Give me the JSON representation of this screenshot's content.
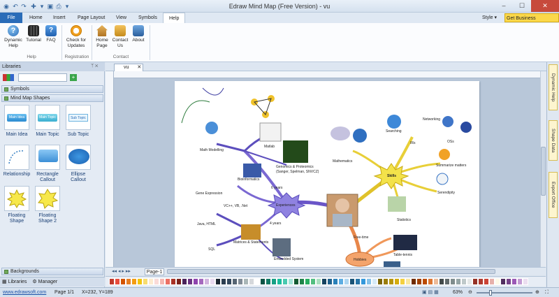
{
  "window": {
    "title": "Edraw Mind Map (Free Version) - vu",
    "minimize": "–",
    "maximize": "☐",
    "close": "✕"
  },
  "tabs": [
    {
      "label": "File"
    },
    {
      "label": "Home"
    },
    {
      "label": "Insert"
    },
    {
      "label": "Page Layout"
    },
    {
      "label": "View"
    },
    {
      "label": "Symbols"
    },
    {
      "label": "Help"
    }
  ],
  "style_label": "Style",
  "business_label": "Get Business Version...",
  "ribbon": {
    "buttons": [
      {
        "label": "Dynamic Help",
        "l1": "Dynamic",
        "l2": "Help"
      },
      {
        "label": "Tutorial",
        "l1": "Tutorial",
        "l2": ""
      },
      {
        "label": "FAQ",
        "l1": "FAQ",
        "l2": ""
      },
      {
        "label": "Check for Updates",
        "l1": "Check for",
        "l2": "Updates"
      },
      {
        "label": "Home Page",
        "l1": "Home",
        "l2": "Page"
      },
      {
        "label": "Contact Us",
        "l1": "Contact",
        "l2": "Us"
      },
      {
        "label": "About",
        "l1": "About",
        "l2": ""
      }
    ],
    "groups": [
      "Help",
      "Registration",
      "Contact"
    ]
  },
  "library": {
    "title": "Libraries",
    "pin": "ᛘ ✕",
    "sections": [
      "Symbols",
      "Mind Map Shapes",
      "Backgrounds"
    ],
    "shapes": [
      {
        "label1": "Main Idea",
        "label2": "",
        "preview": "Main Idea"
      },
      {
        "label1": "Main Topic",
        "label2": "",
        "preview": "Main Topic"
      },
      {
        "label1": "Sub Topic",
        "label2": "",
        "preview": "Sub Topic"
      },
      {
        "label1": "Relationship",
        "label2": ""
      },
      {
        "label1": "Rectangle",
        "label2": "Callout"
      },
      {
        "label1": "Ellipse",
        "label2": "Callout"
      },
      {
        "label1": "Floating",
        "label2": "Shape"
      },
      {
        "label1": "Floating",
        "label2": "Shape 2"
      }
    ],
    "bottom_tabs": [
      "Libraries",
      "Manager"
    ]
  },
  "document": {
    "tab": "vu",
    "page_tab": "Page-1"
  },
  "mindmap": {
    "labels": [
      "Math Modelling",
      "Matlab",
      "Bioinformatics",
      "Genomics & Proteomics",
      "(Sanger, Spelman, SNVCZ)",
      "Gene Expression",
      "6 years",
      "Mathematics",
      "Skills",
      "Searching",
      "Networking",
      "IRs",
      "OSs",
      "Summarize matters",
      "Serendipity",
      "Experiences",
      "VC++, VB, .Net",
      "Java, HTML",
      "SQL",
      "4 years",
      "Hobbies",
      "Free-time",
      "Statistics",
      "Table-tennis",
      "Embedded System",
      "Matrices & Statements"
    ],
    "skills_main": "Skills",
    "experiences_main": "Experiences",
    "hobbies_main": "Hobbies"
  },
  "right_panel": [
    "Dynamic Help",
    "Shape Data",
    "Export Office"
  ],
  "status": {
    "link": "www.edrawsoft.com",
    "page": "Page 1/1",
    "coords": "X=232, Y=189",
    "zoom": "63%"
  },
  "palette": [
    "#c0392b",
    "#e74c3c",
    "#d35400",
    "#e67e22",
    "#f39c12",
    "#f1c40f",
    "#f7dc6f",
    "#fdebd0",
    "#fadbd8",
    "#f5b7b1",
    "#ec7063",
    "#a93226",
    "#7b241c",
    "#4a235a",
    "#6c3483",
    "#8e44ad",
    "#a569bd",
    "#d2b4de",
    "#e8daef",
    "#1b2631",
    "#2c3e50",
    "#34495e",
    "#566573",
    "#808b96",
    "#aab7b8",
    "#d5d8dc",
    "#ffffff",
    "#0b5345",
    "#117a65",
    "#16a085",
    "#1abc9c",
    "#48c9b0",
    "#a3e4d7",
    "#145a32",
    "#1e8449",
    "#27ae60",
    "#52be80",
    "#a9dfbf",
    "#154360",
    "#1f618d",
    "#2980b9",
    "#5dade2",
    "#aed6f1",
    "#1a5276",
    "#2874a6",
    "#3498db",
    "#85c1e9",
    "#d6eaf8",
    "#7d6608",
    "#9a7d0a",
    "#b7950b",
    "#d4ac0d",
    "#f4d03f",
    "#f9e79f",
    "#6e2c00",
    "#a04000",
    "#ba4a00",
    "#dc7633",
    "#edbb99",
    "#424949",
    "#616a6b",
    "#7f8c8d",
    "#95a5a6",
    "#bfc9ca",
    "#e5e8e8",
    "#943126",
    "#b03a2e",
    "#cb4335",
    "#e6b0aa",
    "#fef9e7",
    "#512e5f",
    "#76448a",
    "#9b59b6",
    "#c39bd3",
    "#ebdef0"
  ]
}
